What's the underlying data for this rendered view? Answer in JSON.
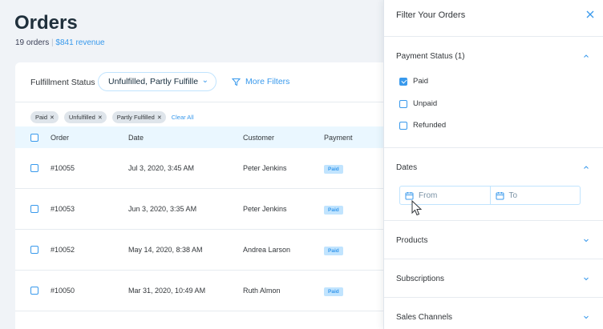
{
  "page": {
    "title": "Orders",
    "orders_count": "19 orders",
    "separator": "|",
    "revenue": "$841 revenue"
  },
  "filter_bar": {
    "fulfillment_label": "Fulfillment Status",
    "fulfillment_value": "Unfulfilled, Partly Fulfille",
    "more_filters": "More Filters"
  },
  "chips": [
    {
      "label": "Paid"
    },
    {
      "label": "Unfulfilled"
    },
    {
      "label": "Partly Fulfilled"
    }
  ],
  "clear_all": "Clear All",
  "table": {
    "columns": [
      "Order",
      "Date",
      "Customer",
      "Payment"
    ],
    "rows": [
      {
        "order": "#10055",
        "date": "Jul 3, 2020, 3:45 AM",
        "customer": "Peter Jenkins",
        "payment": "Paid"
      },
      {
        "order": "#10053",
        "date": "Jun 3, 2020, 3:35 AM",
        "customer": "Peter Jenkins",
        "payment": "Paid"
      },
      {
        "order": "#10052",
        "date": "May 14, 2020, 8:38 AM",
        "customer": "Andrea Larson",
        "payment": "Paid"
      },
      {
        "order": "#10050",
        "date": "Mar 31, 2020, 10:49 AM",
        "customer": "Ruth Almon",
        "payment": "Paid"
      }
    ]
  },
  "panel": {
    "title": "Filter Your Orders",
    "payment_status": {
      "label": "Payment Status (1)",
      "options": [
        {
          "label": "Paid",
          "checked": true
        },
        {
          "label": "Unpaid",
          "checked": false
        },
        {
          "label": "Refunded",
          "checked": false
        }
      ]
    },
    "dates": {
      "label": "Dates",
      "from_placeholder": "From",
      "to_placeholder": "To"
    },
    "products": "Products",
    "subscriptions": "Subscriptions",
    "sales_channels": "Sales Channels"
  },
  "colors": {
    "accent": "#3899ec",
    "accent_light": "#c1e4fe",
    "header_row": "#eaf7ff",
    "background": "#f0f3f7"
  },
  "icons": [
    "filter-icon",
    "close-icon",
    "chevron-up-icon",
    "chevron-down-icon",
    "calendar-icon",
    "mouse-cursor"
  ]
}
